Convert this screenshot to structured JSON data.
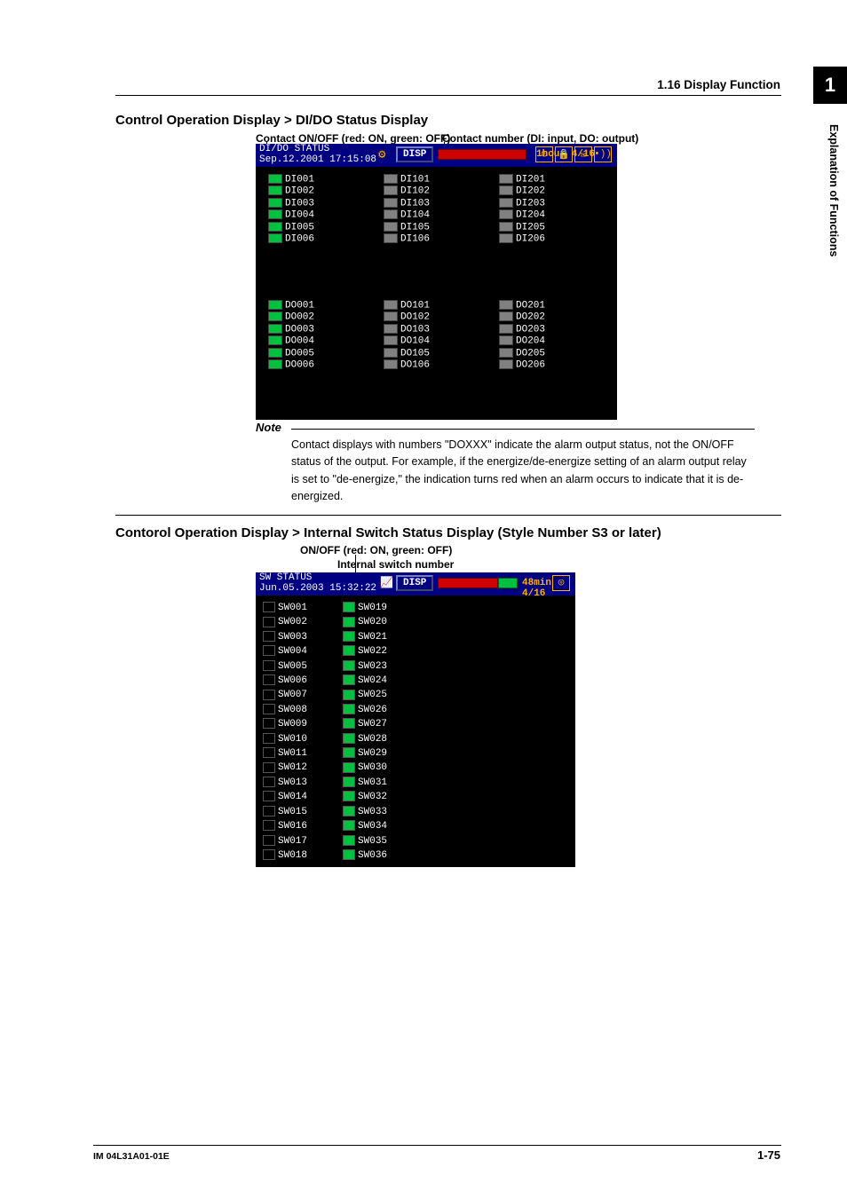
{
  "header": {
    "section": "1.16  Display Function"
  },
  "tab": {
    "number": "1",
    "side_label": "Explanation of Functions"
  },
  "section1": {
    "title": "Control Operation Display > DI/DO Status Display",
    "anno_left": "Contact ON/OFF (red: ON, green: OFF)",
    "anno_right": "Contact number (DI: input, DO: output)",
    "titlebar_line1": "DI/DO STATUS",
    "titlebar_line2": "Sep.12.2001 17:15:08",
    "disp_label": "DISP",
    "rate_label": "1hour 4/16",
    "di_cols": [
      [
        "DI001",
        "DI002",
        "DI003",
        "DI004",
        "DI005",
        "DI006"
      ],
      [
        "DI101",
        "DI102",
        "DI103",
        "DI104",
        "DI105",
        "DI106"
      ],
      [
        "DI201",
        "DI202",
        "DI203",
        "DI204",
        "DI205",
        "DI206"
      ]
    ],
    "do_cols": [
      [
        "DO001",
        "DO002",
        "DO003",
        "DO004",
        "DO005",
        "DO006"
      ],
      [
        "DO101",
        "DO102",
        "DO103",
        "DO104",
        "DO105",
        "DO106"
      ],
      [
        "DO201",
        "DO202",
        "DO203",
        "DO204",
        "DO205",
        "DO206"
      ]
    ],
    "icons": [
      "record-icon",
      "keylock-icon",
      "mail-icon",
      "wave-icon"
    ]
  },
  "note": {
    "label": "Note",
    "body": "Contact displays with numbers \"DOXXX\" indicate the alarm output status, not the ON/OFF status of the output.  For example, if the energize/de-energize setting of an alarm output relay is set to \"de-energize,\" the indication turns red when an alarm occurs to indicate that it is de-energized."
  },
  "section2": {
    "title": "Contorol Operation Display > Internal Switch Status Display (Style Number S3 or later)",
    "anno_top": "ON/OFF (red: ON, green: OFF)",
    "anno_sub": "Internal switch number",
    "titlebar_line1": "SW STATUS",
    "titlebar_line2": "Jun.05.2003 15:32:22",
    "disp_label": "DISP",
    "rate_label": "48min  4/16",
    "sw_cols": [
      [
        "SW001",
        "SW002",
        "SW003",
        "SW004",
        "SW005",
        "SW006",
        "SW007",
        "SW008",
        "SW009",
        "SW010",
        "SW011",
        "SW012",
        "SW013",
        "SW014",
        "SW015",
        "SW016",
        "SW017",
        "SW018"
      ],
      [
        "SW019",
        "SW020",
        "SW021",
        "SW022",
        "SW023",
        "SW024",
        "SW025",
        "SW026",
        "SW027",
        "SW028",
        "SW029",
        "SW030",
        "SW031",
        "SW032",
        "SW033",
        "SW034",
        "SW035",
        "SW036"
      ]
    ],
    "icons": [
      "record-icon"
    ]
  },
  "footer": {
    "left": "IM 04L31A01-01E",
    "right": "1-75"
  }
}
